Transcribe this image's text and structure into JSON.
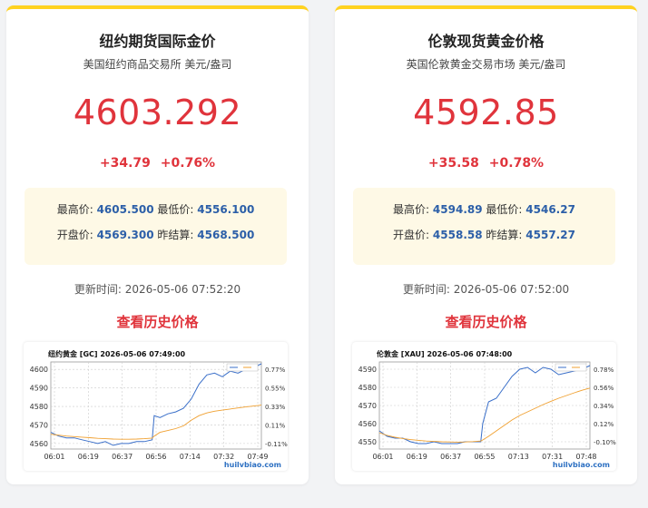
{
  "cards": [
    {
      "title": "纽约期货国际金价",
      "subtitle": "美国纽约商品交易所 美元/盎司",
      "price": "4603.292",
      "change_abs": "+34.79",
      "change_pct": "+0.76%",
      "high_label": "最高价:",
      "high": "4605.500",
      "low_label": "最低价:",
      "low": "4556.100",
      "open_label": "开盘价:",
      "open": "4569.300",
      "prev_label": "昨结算:",
      "prev": "4568.500",
      "updated": "更新时间: 2026-05-06 07:52:20",
      "history_link": "查看历史价格",
      "chart_title": "纽约黄金 [GC]  2026-05-06 07:49:00",
      "watermark": "huilvbiao.com"
    },
    {
      "title": "伦敦现货黄金价格",
      "subtitle": "英国伦敦黄金交易市场 美元/盎司",
      "price": "4592.85",
      "change_abs": "+35.58",
      "change_pct": "+0.78%",
      "high_label": "最高价:",
      "high": "4594.89",
      "low_label": "最低价:",
      "low": "4546.27",
      "open_label": "开盘价:",
      "open": "4558.58",
      "prev_label": "昨结算:",
      "prev": "4557.27",
      "updated": "更新时间: 2026-05-06 07:52:00",
      "history_link": "查看历史价格",
      "chart_title": "伦敦金 [XAU]  2026-05-06 07:48:00",
      "watermark": "huilvbiao.com"
    }
  ],
  "colors": {
    "accent": "#e0343c",
    "value": "#2c5fa8",
    "price_line": "#3a6fc9",
    "avg_line": "#f0a030",
    "top_bar": "#ffd21f"
  },
  "chart_data": [
    {
      "type": "line",
      "title": "纽约黄金 [GC]  2026-05-06 07:49:00",
      "xticks": [
        "06:01",
        "06:19",
        "06:37",
        "06:56",
        "07:14",
        "07:32",
        "07:49"
      ],
      "yticks": [
        4560,
        4570,
        4580,
        4590,
        4600
      ],
      "ylim": [
        4557,
        4604
      ],
      "y2ticks": [
        "-0.11%",
        "0.11%",
        "0.33%",
        "0.55%",
        "0.77%"
      ],
      "x": [
        0,
        4,
        8,
        12,
        16,
        20,
        24,
        28,
        32,
        36,
        40,
        44,
        48,
        52,
        53,
        56,
        60,
        64,
        68,
        72,
        76,
        80,
        84,
        88,
        92,
        96,
        100,
        104,
        108
      ],
      "series": [
        {
          "values": [
            4566,
            4564,
            4563,
            4563,
            4562,
            4561,
            4560,
            4561,
            4559,
            4560,
            4560,
            4561,
            4561,
            4562,
            4575,
            4574,
            4576,
            4577,
            4579,
            4584,
            4592,
            4597,
            4598,
            4596,
            4599,
            4598,
            4600,
            4601,
            4603
          ]
        },
        {
          "values": [
            4565,
            4564.5,
            4564,
            4563.7,
            4563.4,
            4563.1,
            4562.8,
            4562.6,
            4562.4,
            4562.3,
            4562.3,
            4562.4,
            4562.6,
            4562.9,
            4564,
            4566,
            4567,
            4568,
            4569.5,
            4572.5,
            4575,
            4576.5,
            4577.4,
            4578,
            4578.6,
            4579.2,
            4579.7,
            4580.2,
            4580.7
          ]
        }
      ]
    },
    {
      "type": "line",
      "title": "伦敦金 [XAU]  2026-05-06 07:48:00",
      "xticks": [
        "06:01",
        "06:19",
        "06:37",
        "06:55",
        "07:13",
        "07:31",
        "07:48"
      ],
      "yticks": [
        4550,
        4560,
        4570,
        4580,
        4590
      ],
      "ylim": [
        4546,
        4594
      ],
      "y2ticks": [
        "-0.10%",
        "0.12%",
        "0.34%",
        "0.56%",
        "0.78%"
      ],
      "x": [
        0,
        4,
        8,
        12,
        16,
        20,
        24,
        28,
        32,
        36,
        40,
        44,
        48,
        52,
        53,
        56,
        60,
        64,
        68,
        72,
        76,
        80,
        84,
        88,
        92,
        96,
        100,
        104,
        108
      ],
      "series": [
        {
          "values": [
            4556,
            4553,
            4552,
            4552,
            4550,
            4549,
            4549,
            4550,
            4549,
            4549,
            4549,
            4550,
            4550,
            4550,
            4560,
            4572,
            4574,
            4580,
            4586,
            4590,
            4591,
            4588,
            4591,
            4590,
            4587,
            4588,
            4589,
            4590,
            4592
          ]
        },
        {
          "values": [
            4555,
            4553.5,
            4552.5,
            4551.8,
            4551.2,
            4550.8,
            4550.4,
            4550.2,
            4550,
            4549.9,
            4549.8,
            4549.9,
            4550.1,
            4550.4,
            4551,
            4553,
            4556,
            4559,
            4562,
            4564.5,
            4566.5,
            4568.5,
            4570.5,
            4572.3,
            4574,
            4575.5,
            4577,
            4578.4,
            4579.6
          ]
        }
      ]
    }
  ]
}
